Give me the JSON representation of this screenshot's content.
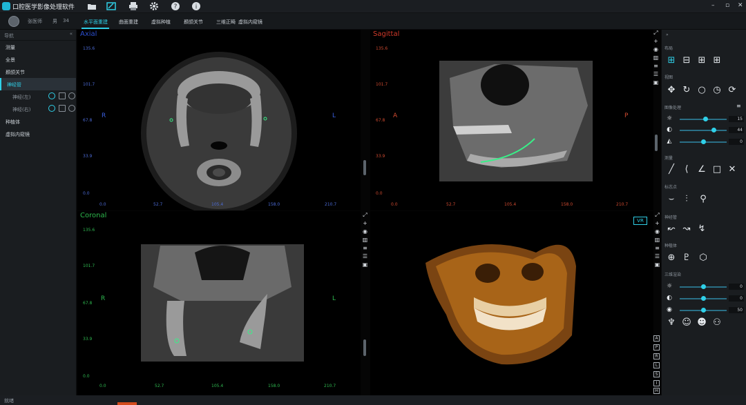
{
  "app": {
    "title": "口腔医学影像处理软件"
  },
  "nav": {
    "user_name": "张医师",
    "user_meta_1": "男",
    "user_meta_2": "34",
    "tabs": [
      "水平面重建",
      "曲面重建",
      "虚拟种植",
      "颞颌关节",
      "三维正畸",
      "虚拟内窥镜"
    ]
  },
  "left": {
    "header": "导航",
    "items": [
      "测量",
      "全景",
      "颞颌关节",
      "神经管",
      "神经(左)",
      "神经(右)",
      "种植体",
      "虚拟内窥镜"
    ]
  },
  "views": {
    "axial": {
      "title": "Axial",
      "left": "R",
      "right": "L",
      "yticks": [
        "135.6",
        "101.7",
        "67.8",
        "33.9",
        "0.0"
      ],
      "xticks": [
        "0.0",
        "52.7",
        "105.4",
        "158.0",
        "210.7"
      ]
    },
    "sagittal": {
      "title": "Sagittal",
      "left": "A",
      "right": "P",
      "yticks": [
        "135.6",
        "101.7",
        "67.8",
        "33.9",
        "0.0"
      ],
      "xticks": [
        "0.0",
        "52.7",
        "105.4",
        "158.0",
        "210.7"
      ]
    },
    "coronal": {
      "title": "Coronal",
      "left": "R",
      "right": "L",
      "yticks": [
        "135.6",
        "101.7",
        "67.8",
        "33.9",
        "0.0"
      ],
      "xticks": [
        "0.0",
        "52.7",
        "105.4",
        "158.0",
        "210.7"
      ]
    },
    "vr": {
      "badge": "VR",
      "orient": [
        "A",
        "P",
        "R",
        "L",
        "S",
        "I",
        "H"
      ]
    }
  },
  "right": {
    "sections": [
      "布局",
      "视图",
      "图像处理",
      "测量",
      "标志点",
      "神经管",
      "种植体",
      "三维渲染"
    ],
    "image_proc": [
      {
        "icon": "brightness-icon",
        "value": "15",
        "level": 0.55
      },
      {
        "icon": "contrast-icon",
        "value": "44",
        "level": 0.72
      },
      {
        "icon": "sharpen-icon",
        "value": "0",
        "level": 0.5
      }
    ],
    "render3d": [
      {
        "icon": "light-icon",
        "value": "0",
        "level": 0.5
      },
      {
        "icon": "opacity-icon",
        "value": "0",
        "level": 0.5
      },
      {
        "icon": "threshold-icon",
        "value": "50",
        "level": 0.5
      }
    ]
  },
  "status": {
    "text": "就绪"
  },
  "colors": {
    "accent": "#2fd0e8",
    "axial_label": "#2b4fd0",
    "sagittal_label": "#d23a2a",
    "coronal_label": "#2db84c",
    "axial_side": "#3a5fe0",
    "sagittal_side": "#d04a30",
    "coronal_side": "#2fb850"
  }
}
